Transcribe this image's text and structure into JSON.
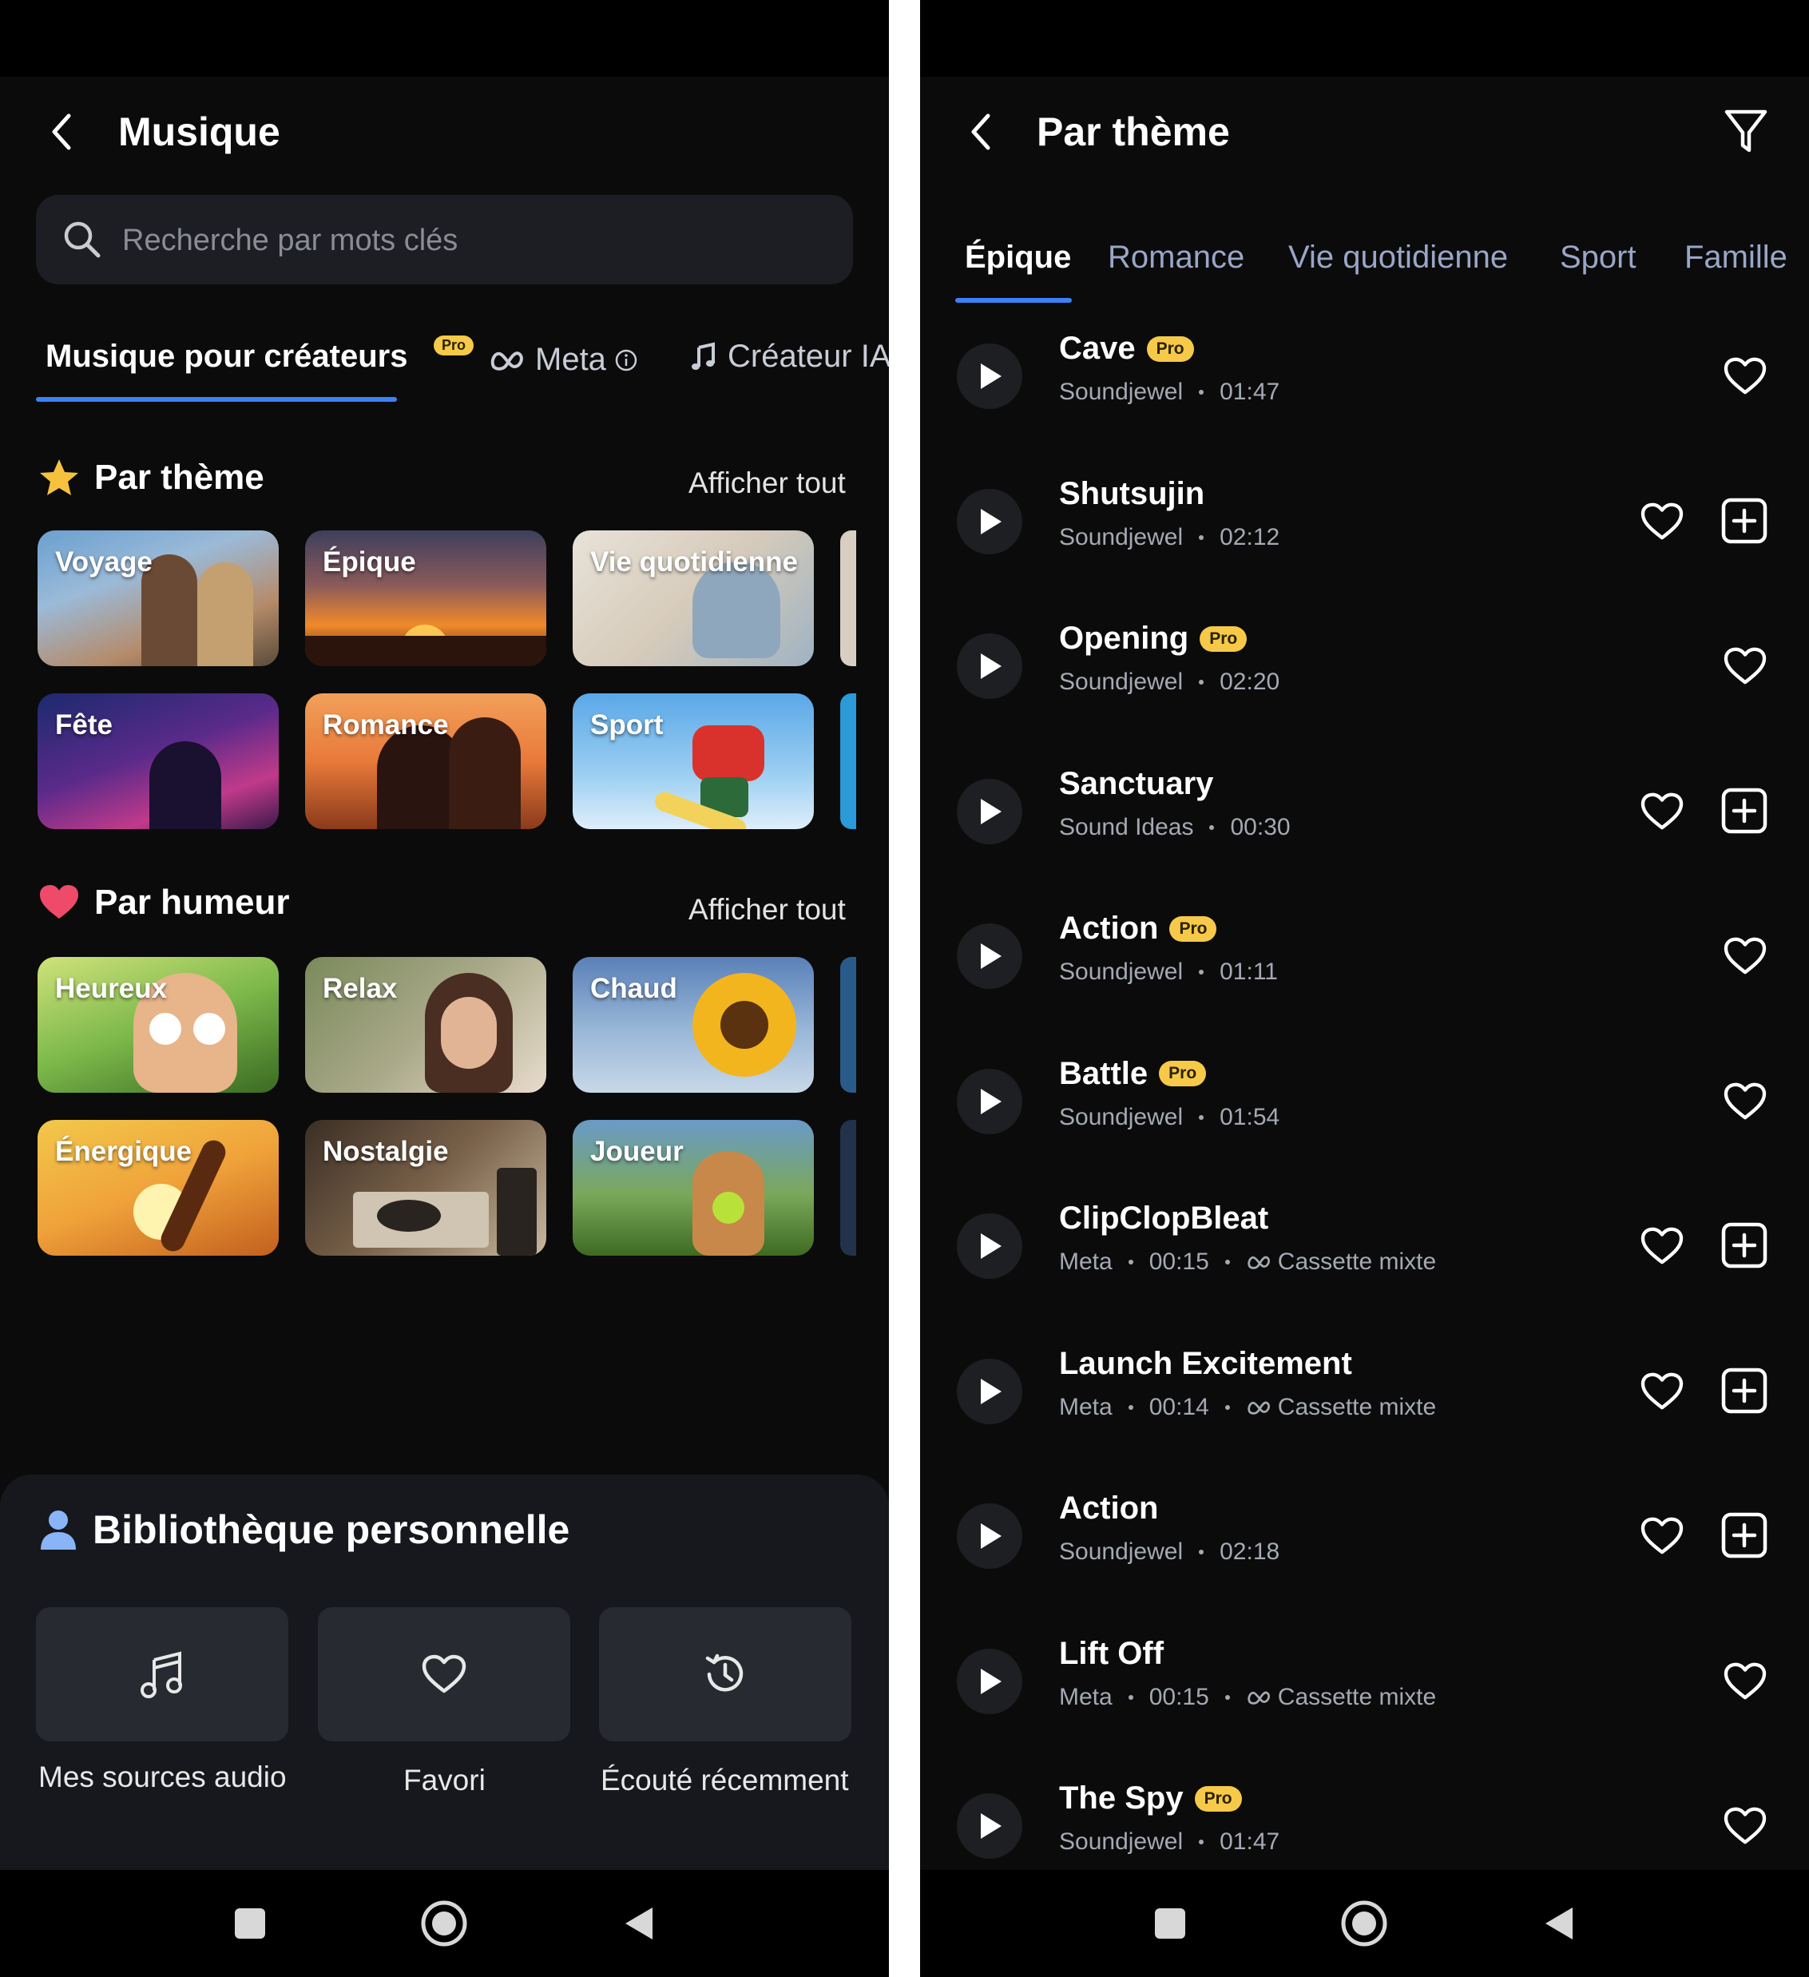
{
  "left": {
    "title": "Musique",
    "search": {
      "placeholder": "Recherche par mots clés"
    },
    "tabs": [
      {
        "label": "Musique pour créateurs",
        "active": true
      },
      {
        "label": "Meta",
        "badge": "Pro",
        "icon": "meta-icon",
        "info_icon": "info-icon"
      },
      {
        "label": "Créateur IA",
        "icon": "music-note-icon"
      }
    ],
    "by_theme": {
      "title": "Par thème",
      "icon": "star-icon",
      "show_all": "Afficher tout",
      "tiles": [
        "Voyage",
        "Épique",
        "Vie quotidienne",
        "Fête",
        "Romance",
        "Sport"
      ]
    },
    "by_mood": {
      "title": "Par humeur",
      "icon": "heart-icon",
      "show_all": "Afficher tout",
      "tiles": [
        "Heureux",
        "Relax",
        "Chaud",
        "Énergique",
        "Nostalgie",
        "Joueur"
      ]
    },
    "library": {
      "title": "Bibliothèque personnelle",
      "icon": "user-icon",
      "items": [
        {
          "label": "Mes sources audio",
          "icon": "music-note-icon"
        },
        {
          "label": "Favori",
          "icon": "heart-icon"
        },
        {
          "label": "Écouté récemment",
          "icon": "history-icon"
        }
      ]
    }
  },
  "right": {
    "title": "Par thème",
    "filter_icon": "filter-icon",
    "tabs": [
      "Épique",
      "Romance",
      "Vie quotidienne",
      "Sport",
      "Famille"
    ],
    "active_tab": "Épique",
    "tracks": [
      {
        "title": "Cave",
        "pro": "Pro",
        "artist": "Soundjewel",
        "duration": "01:47",
        "extra": "",
        "add": false
      },
      {
        "title": "Shutsujin",
        "pro": "",
        "artist": "Soundjewel",
        "duration": "02:12",
        "extra": "",
        "add": true
      },
      {
        "title": "Opening",
        "pro": "Pro",
        "artist": "Soundjewel",
        "duration": "02:20",
        "extra": "",
        "add": false
      },
      {
        "title": "Sanctuary",
        "pro": "",
        "artist": "Sound Ideas",
        "duration": "00:30",
        "extra": "",
        "add": true
      },
      {
        "title": "Action",
        "pro": "Pro",
        "artist": "Soundjewel",
        "duration": "01:11",
        "extra": "",
        "add": false
      },
      {
        "title": "Battle",
        "pro": "Pro",
        "artist": "Soundjewel",
        "duration": "01:54",
        "extra": "",
        "add": false
      },
      {
        "title": "ClipClopBleat",
        "pro": "",
        "artist": "Meta",
        "duration": "00:15",
        "extra": "Cassette mixte",
        "add": true
      },
      {
        "title": "Launch Excitement",
        "pro": "",
        "artist": "Meta",
        "duration": "00:14",
        "extra": "Cassette mixte",
        "add": true
      },
      {
        "title": "Action",
        "pro": "",
        "artist": "Soundjewel",
        "duration": "02:18",
        "extra": "",
        "add": true
      },
      {
        "title": "Lift Off",
        "pro": "",
        "artist": "Meta",
        "duration": "00:15",
        "extra": "Cassette mixte",
        "add": false
      },
      {
        "title": "The Spy",
        "pro": "Pro",
        "artist": "Soundjewel",
        "duration": "01:47",
        "extra": "",
        "add": false
      }
    ]
  },
  "system_nav": {
    "icons": [
      "recents-icon",
      "home-icon",
      "back-icon"
    ]
  },
  "colors": {
    "accent": "#3b82f6",
    "pro_badge": "#f7c948",
    "background": "#0b0b0b"
  }
}
